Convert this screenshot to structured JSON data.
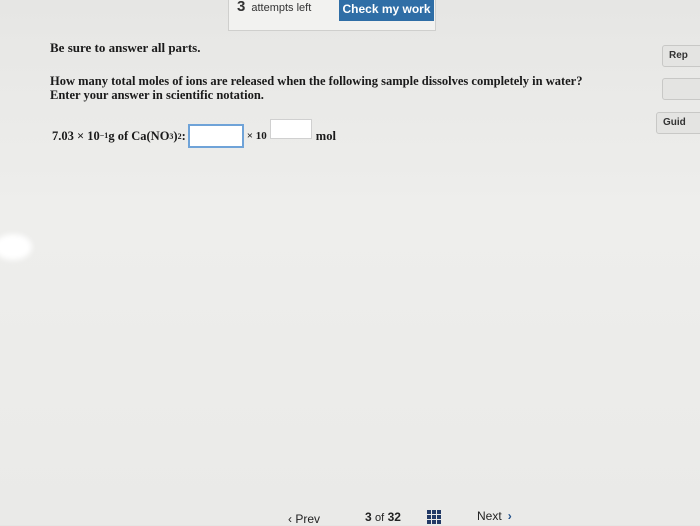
{
  "toolbar": {
    "attempts_count": "3",
    "attempts_label": "attempts left",
    "check_button": "Check my work"
  },
  "side_tools": {
    "report_label": "Rep",
    "guided_label": "Guid"
  },
  "content": {
    "instruction": "Be sure to answer all parts.",
    "question_line1": "How many total moles of ions are released when the following sample dissolves completely in water?",
    "question_line2": "Enter your answer in scientific notation.",
    "mass_coefficient": "7.03 × 10",
    "mass_exponent": "−1",
    "mass_unit": " g of Ca(NO",
    "formula_sub1": "3",
    "formula_close": ")",
    "formula_sub2": "2",
    "formula_colon": ":",
    "times_ten": "× 10",
    "answer_unit": "mol"
  },
  "footer": {
    "prev_label": "‹ Prev",
    "page_current": "3",
    "page_of": "of",
    "page_total": "32",
    "next_label": "Next",
    "next_arrow": "›"
  }
}
